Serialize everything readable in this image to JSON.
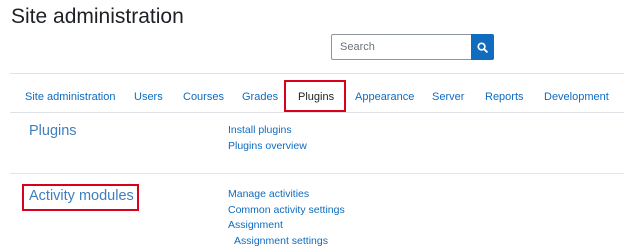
{
  "page": {
    "title": "Site administration"
  },
  "search": {
    "placeholder": "Search",
    "icon": "search-icon"
  },
  "tabs": [
    {
      "label": "Site administration"
    },
    {
      "label": "Users"
    },
    {
      "label": "Courses"
    },
    {
      "label": "Grades"
    },
    {
      "label": "Plugins",
      "active": true
    },
    {
      "label": "Appearance"
    },
    {
      "label": "Server"
    },
    {
      "label": "Reports"
    },
    {
      "label": "Development"
    }
  ],
  "sections": [
    {
      "title": "Plugins",
      "links": [
        "Install plugins",
        "Plugins overview"
      ]
    },
    {
      "title": "Activity modules",
      "links": [
        "Manage activities",
        "Common activity settings",
        "Assignment",
        "Assignment settings"
      ]
    }
  ],
  "colors": {
    "link": "#0f6cbf",
    "section_title": "#3f7fbf",
    "highlight": "#d9001b",
    "search_button": "#0f6cbf"
  }
}
